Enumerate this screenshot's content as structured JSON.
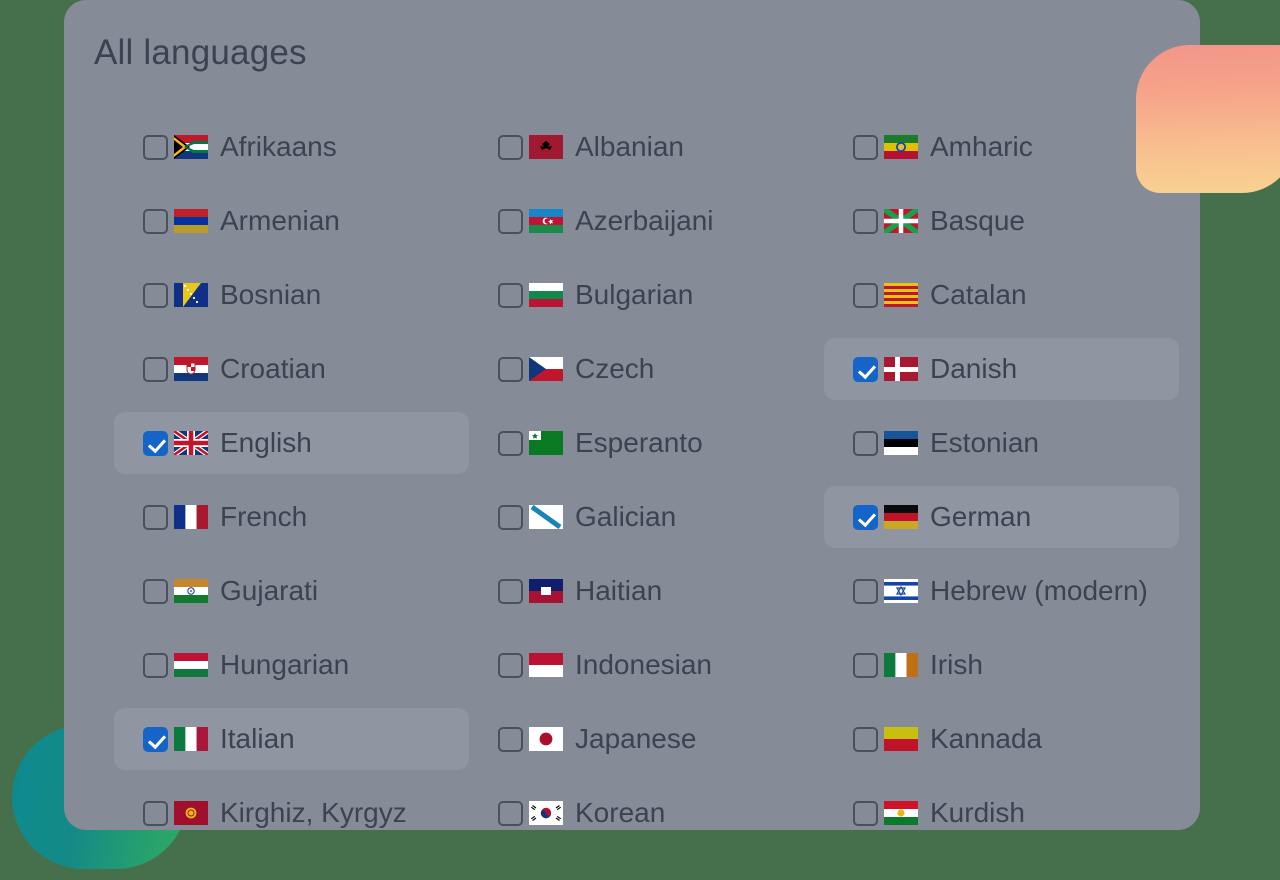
{
  "panel": {
    "title": "All languages"
  },
  "colors": {
    "panel_bg": "#868b98",
    "row_selected_bg": "#8f95a1",
    "text": "#3b4351",
    "checkbox_checked": "#1565c8",
    "checkbox_border": "#4a515e",
    "page_bg_green": "#46704c",
    "blob_teal_start": "#0d8a90",
    "blob_teal_end": "#2faa64",
    "blob_peach_start": "#f3958b",
    "blob_peach_end": "#f8d292"
  },
  "languages": [
    {
      "label": "Afrikaans",
      "flag": "za",
      "checked": false,
      "column": 1,
      "row": 1
    },
    {
      "label": "Albanian",
      "flag": "al",
      "checked": false,
      "column": 2,
      "row": 1
    },
    {
      "label": "Amharic",
      "flag": "et",
      "checked": false,
      "column": 3,
      "row": 1
    },
    {
      "label": "Armenian",
      "flag": "am",
      "checked": false,
      "column": 1,
      "row": 2
    },
    {
      "label": "Azerbaijani",
      "flag": "az",
      "checked": false,
      "column": 2,
      "row": 2
    },
    {
      "label": "Basque",
      "flag": "eus",
      "checked": false,
      "column": 3,
      "row": 2
    },
    {
      "label": "Bosnian",
      "flag": "ba",
      "checked": false,
      "column": 1,
      "row": 3
    },
    {
      "label": "Bulgarian",
      "flag": "bg",
      "checked": false,
      "column": 2,
      "row": 3
    },
    {
      "label": "Catalan",
      "flag": "cat",
      "checked": false,
      "column": 3,
      "row": 3
    },
    {
      "label": "Croatian",
      "flag": "hr",
      "checked": false,
      "column": 1,
      "row": 4
    },
    {
      "label": "Czech",
      "flag": "cz",
      "checked": false,
      "column": 2,
      "row": 4
    },
    {
      "label": "Danish",
      "flag": "dk",
      "checked": true,
      "column": 3,
      "row": 4
    },
    {
      "label": "English",
      "flag": "gb",
      "checked": true,
      "column": 1,
      "row": 5
    },
    {
      "label": "Esperanto",
      "flag": "epo",
      "checked": false,
      "column": 2,
      "row": 5
    },
    {
      "label": "Estonian",
      "flag": "ee",
      "checked": false,
      "column": 3,
      "row": 5
    },
    {
      "label": "French",
      "flag": "fr",
      "checked": false,
      "column": 1,
      "row": 6
    },
    {
      "label": "Galician",
      "flag": "glg",
      "checked": false,
      "column": 2,
      "row": 6
    },
    {
      "label": "German",
      "flag": "de",
      "checked": true,
      "column": 3,
      "row": 6
    },
    {
      "label": "Gujarati",
      "flag": "in",
      "checked": false,
      "column": 1,
      "row": 7
    },
    {
      "label": "Haitian",
      "flag": "ht",
      "checked": false,
      "column": 2,
      "row": 7
    },
    {
      "label": "Hebrew (modern)",
      "flag": "il",
      "checked": false,
      "column": 3,
      "row": 7
    },
    {
      "label": "Hungarian",
      "flag": "hu",
      "checked": false,
      "column": 1,
      "row": 8
    },
    {
      "label": "Indonesian",
      "flag": "id",
      "checked": false,
      "column": 2,
      "row": 8
    },
    {
      "label": "Irish",
      "flag": "ie",
      "checked": false,
      "column": 3,
      "row": 8
    },
    {
      "label": "Italian",
      "flag": "it",
      "checked": true,
      "column": 1,
      "row": 9
    },
    {
      "label": "Japanese",
      "flag": "jp",
      "checked": false,
      "column": 2,
      "row": 9
    },
    {
      "label": "Kannada",
      "flag": "kan",
      "checked": false,
      "column": 3,
      "row": 9
    },
    {
      "label": "Kirghiz, Kyrgyz",
      "flag": "kg",
      "checked": false,
      "column": 1,
      "row": 10
    },
    {
      "label": "Korean",
      "flag": "kr",
      "checked": false,
      "column": 2,
      "row": 10
    },
    {
      "label": "Kurdish",
      "flag": "ku",
      "checked": false,
      "column": 3,
      "row": 10
    }
  ]
}
